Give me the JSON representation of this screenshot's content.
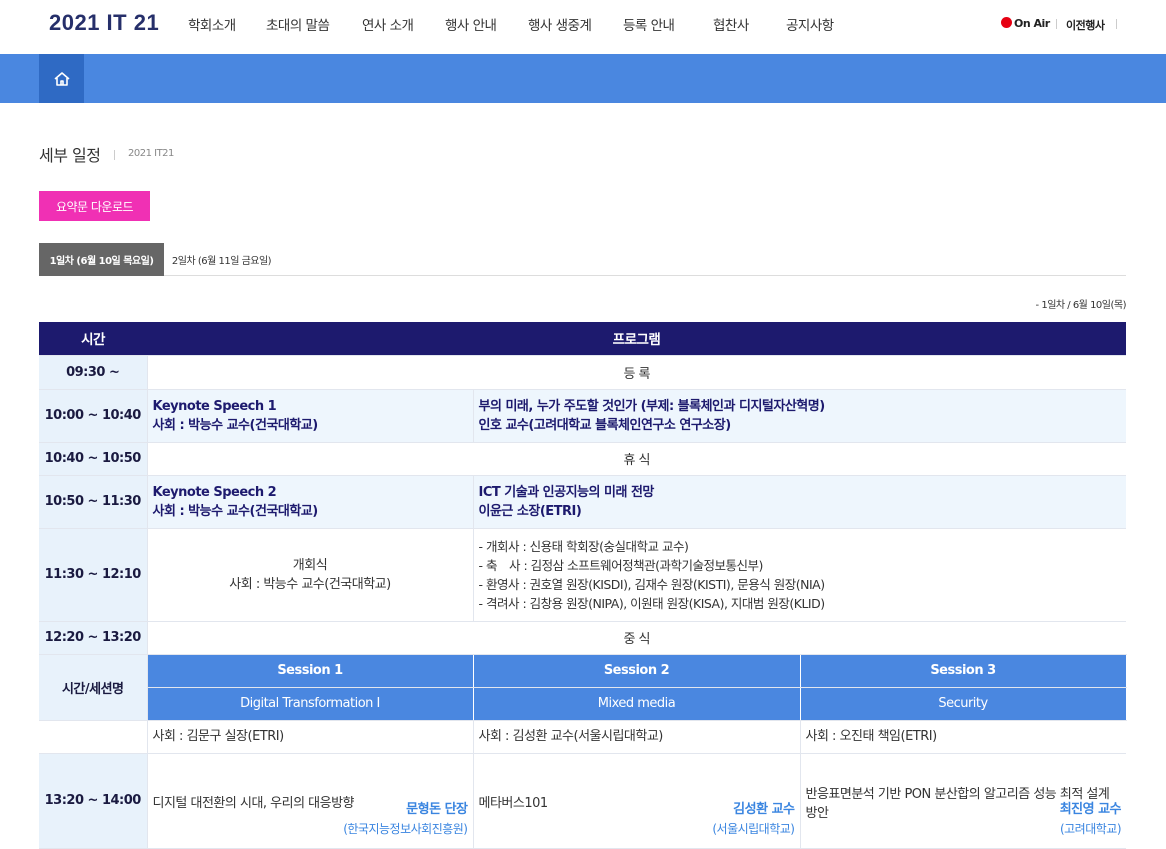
{
  "header": {
    "logo": "2021 IT 21",
    "nav": [
      "학회소개",
      "초대의 말씀",
      "연사 소개",
      "행사 안내",
      "행사 생중계",
      "등록 안내",
      "협찬사",
      "공지사항"
    ],
    "on_air": "On Air",
    "previous_events": "이전행사"
  },
  "page": {
    "title": "세부 일정",
    "subtitle": "2021 IT21",
    "download_button": "요약문 다운로드",
    "tabs": [
      "1일차 (6월 10일 목요일)",
      "2일차 (6월 11일 금요일)"
    ],
    "date_note": "- 1일차 / 6월 10일(목)"
  },
  "table": {
    "head": {
      "time": "시간",
      "program": "프로그램"
    },
    "rows": {
      "r1": {
        "time": "09:30 ~",
        "text": "등 록"
      },
      "r2": {
        "time": "10:00 ~ 10:40",
        "left1": "Keynote Speech 1",
        "left2": "사회 : 박능수 교수(건국대학교)",
        "right1": "부의 미래, 누가 주도할 것인가 (부제: 블록체인과 디지털자산혁명)",
        "right2": "인호 교수(고려대학교 블록체인연구소 연구소장)"
      },
      "r3": {
        "time": "10:40 ~ 10:50",
        "text": "휴 식"
      },
      "r4": {
        "time": "10:50 ~ 11:30",
        "left1": "Keynote Speech 2",
        "left2": "사회 : 박능수 교수(건국대학교)",
        "right1": "ICT 기술과 인공지능의 미래 전망",
        "right2": "이윤근 소장(ETRI)"
      },
      "r5": {
        "time": "11:30 ~ 12:10",
        "left1": "개회식",
        "left2": "사회 : 박능수 교수(건국대학교)",
        "lines": [
          "- 개회사 : 신용태 학회장(숭실대학교 교수)",
          "- 축　사 : 김정삼 소프트웨어정책관(과학기술정보통신부)",
          "- 환영사 : 권호열 원장(KISDI), 김재수 원장(KISTI), 문용식 원장(NIA)",
          "- 격려사 : 김창용 원장(NIPA), 이원태 원장(KISA), 지대범 원장(KLID)"
        ]
      },
      "r6": {
        "time": "12:20 ~ 13:20",
        "text": "중 식"
      }
    },
    "session_header": "시간/세션명",
    "sessions": [
      {
        "name": "Session 1",
        "topic": "Digital Transformation I",
        "chair": "사회 : 김문구 실장(ETRI)",
        "talk": "디지털 대전환의 시대, 우리의 대응방향",
        "speaker": "문형돈 단장",
        "affil": "(한국지능정보사회진흥원)"
      },
      {
        "name": "Session 2",
        "topic": "Mixed media",
        "chair": "사회 : 김성환 교수(서울시립대학교)",
        "talk": "메타버스101",
        "speaker": "김성환 교수",
        "affil": "(서울시립대학교)"
      },
      {
        "name": "Session 3",
        "topic": "Security",
        "chair": "사회 : 오진태 책임(ETRI)",
        "talk": "반응표면분석 기반 PON 분산합의 알고리즘 성능 최적 설계 방안",
        "speaker": "최진영 교수",
        "affil": "(고려대학교)"
      }
    ],
    "talk_time": "13:20 ~ 14:00"
  }
}
